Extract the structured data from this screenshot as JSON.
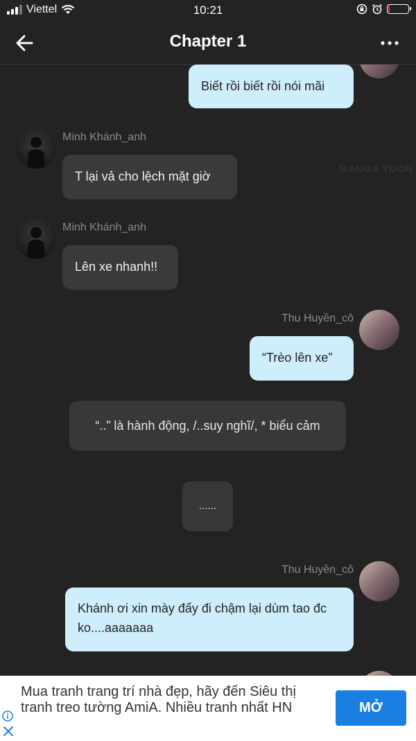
{
  "status_bar": {
    "carrier": "Viettel",
    "time": "10:21",
    "battery_level": 0.08
  },
  "header": {
    "title": "Chapter 1",
    "back_icon": "arrow-left-icon",
    "more_icon": "more-horizontal-icon"
  },
  "watermark": "MANGA TOON",
  "messages": [
    {
      "type": "out",
      "sender": "",
      "text": "Biết rồi biết rồi nói mãi"
    },
    {
      "type": "in",
      "sender": "Minh Khánh_anh",
      "text": "T lại vả cho lệch mặt giờ"
    },
    {
      "type": "in",
      "sender": "Minh Khánh_anh",
      "text": "Lên xe nhanh!!"
    },
    {
      "type": "out",
      "sender": "Thu Huyền_cô",
      "text": "“Trèo lên xe”"
    },
    {
      "type": "system",
      "text": "“..” là hành động, /..suy nghĩ/, * biểu cảm"
    },
    {
      "type": "system",
      "text": "......"
    },
    {
      "type": "out",
      "sender": "Thu Huyền_cô",
      "text": "Khánh ơi xin mày đấy đi chậm lại dùm tao đc ko....aaaaaaa"
    }
  ],
  "ad": {
    "text": "Mua tranh trang trí nhà đẹp, hãy đến Siêu thị tranh treo tường AmiA. Nhiều tranh nhất HN",
    "button_label": "MỞ",
    "button_color": "#1a7fe3",
    "info_icon": "info-icon",
    "close_icon": "close-icon"
  },
  "colors": {
    "background": "#232323",
    "incoming_bubble": "#3a3a3a",
    "outgoing_bubble": "#cfeefb"
  }
}
